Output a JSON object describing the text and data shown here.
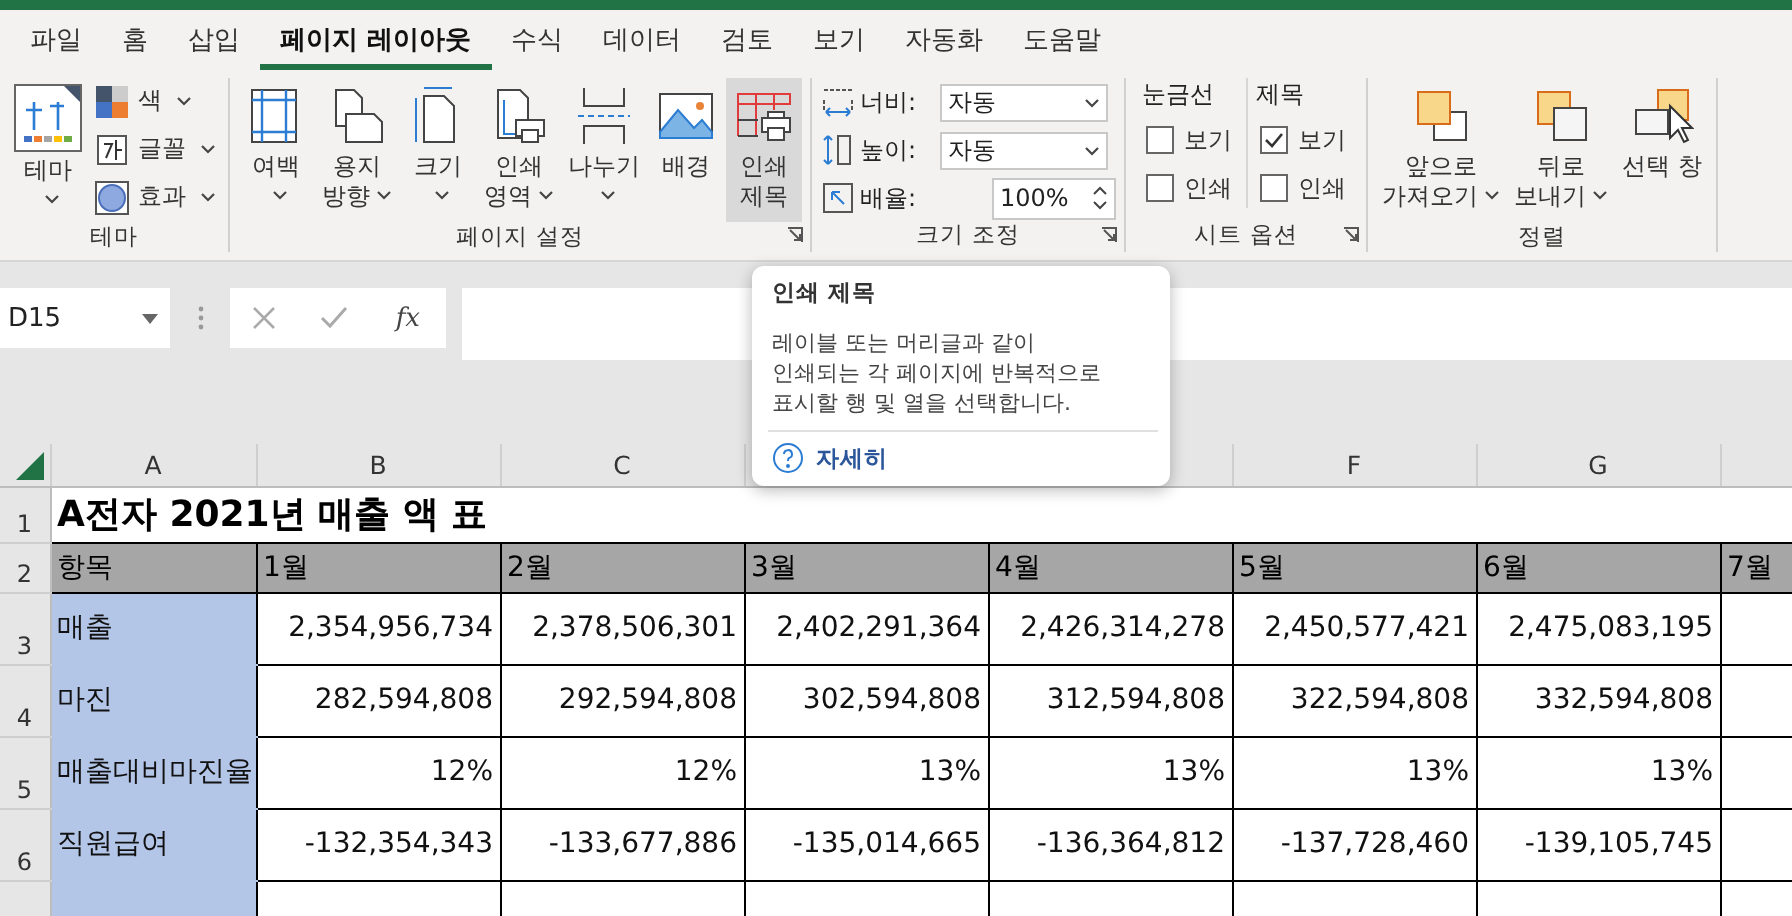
{
  "tabs": [
    {
      "label": "파일",
      "selected": false
    },
    {
      "label": "홈",
      "selected": false
    },
    {
      "label": "삽입",
      "selected": false
    },
    {
      "label": "페이지 레이아웃",
      "selected": true
    },
    {
      "label": "수식",
      "selected": false
    },
    {
      "label": "데이터",
      "selected": false
    },
    {
      "label": "검토",
      "selected": false
    },
    {
      "label": "보기",
      "selected": false
    },
    {
      "label": "자동화",
      "selected": false
    },
    {
      "label": "도움말",
      "selected": false
    }
  ],
  "ribbon": {
    "groups": [
      {
        "kind": "theme",
        "label": "테마",
        "large": {
          "label": "테마",
          "dropdown": true
        },
        "items": [
          {
            "label": "색",
            "dropdown": true
          },
          {
            "label": "글꼴",
            "dropdown": true
          },
          {
            "label": "효과",
            "dropdown": true
          }
        ]
      },
      {
        "kind": "buttons",
        "label": "페이지 설정",
        "launcher": true,
        "buttons": [
          {
            "lines": [
              "여백"
            ],
            "dropdown": true,
            "highlighted": false
          },
          {
            "lines": [
              "용지",
              "방향"
            ],
            "dropdown": true,
            "highlighted": false
          },
          {
            "lines": [
              "크기"
            ],
            "dropdown": true,
            "highlighted": false
          },
          {
            "lines": [
              "인쇄",
              "영역"
            ],
            "dropdown": true,
            "highlighted": false
          },
          {
            "lines": [
              "나누기"
            ],
            "dropdown": true,
            "highlighted": false
          },
          {
            "lines": [
              "배경"
            ],
            "dropdown": false,
            "highlighted": false
          },
          {
            "lines": [
              "인쇄",
              "제목"
            ],
            "dropdown": false,
            "highlighted": true
          }
        ]
      },
      {
        "kind": "scale",
        "label": "크기 조정",
        "launcher": true,
        "fields": [
          {
            "kind": "dropdown",
            "label": "너비:",
            "value": "자동"
          },
          {
            "kind": "dropdown",
            "label": "높이:",
            "value": "자동"
          },
          {
            "kind": "spinner",
            "label": "배율:",
            "value": "100%"
          }
        ]
      },
      {
        "kind": "sheet_options",
        "label": "시트 옵션",
        "launcher": true,
        "sections": [
          {
            "title": "눈금선",
            "options": [
              {
                "label": "보기",
                "checked": false
              },
              {
                "label": "인쇄",
                "checked": false
              }
            ]
          },
          {
            "title": "제목",
            "options": [
              {
                "label": "보기",
                "checked": true
              },
              {
                "label": "인쇄",
                "checked": false
              }
            ]
          }
        ]
      },
      {
        "kind": "buttons",
        "label": "정렬",
        "launcher": false,
        "buttons": [
          {
            "lines": [
              "앞으로",
              "가져오기"
            ],
            "dropdown": true,
            "highlighted": false
          },
          {
            "lines": [
              "뒤로",
              "보내기"
            ],
            "dropdown": true,
            "highlighted": false
          },
          {
            "lines": [
              "선택 창"
            ],
            "dropdown": false,
            "highlighted": false
          }
        ]
      }
    ]
  },
  "formula_bar": {
    "name_box": "D15",
    "function_label": "fx"
  },
  "tooltip": {
    "title": "인쇄 제목",
    "body": "레이블 또는 머리글과 같이\n인쇄되는 각 페이지에 반복적으로\n표시할 행 및 열을 선택합니다.",
    "link": "자세히"
  },
  "sheet": {
    "columns": [
      {
        "label": "A"
      },
      {
        "label": "B"
      },
      {
        "label": "C"
      },
      {},
      {},
      {
        "label": "F"
      },
      {
        "label": "G"
      },
      {}
    ],
    "row_numbers": [
      "1",
      "2",
      "3",
      "4",
      "5",
      "6"
    ],
    "title": "A전자 2021년 매출 액 표",
    "header_row": [
      "항목",
      "1월",
      "2월",
      "3월",
      "4월",
      "5월",
      "6월",
      "7월"
    ],
    "rows": [
      {
        "label": "매출",
        "values": [
          "2,354,956,734",
          "2,378,506,301",
          "2,402,291,364",
          "2,426,314,278",
          "2,450,577,421",
          "2,475,083,195"
        ]
      },
      {
        "label": "마진",
        "values": [
          "282,594,808",
          "292,594,808",
          "302,594,808",
          "312,594,808",
          "322,594,808",
          "332,594,808"
        ]
      },
      {
        "label": "매출대비마진율",
        "values": [
          "12%",
          "12%",
          "13%",
          "13%",
          "13%",
          "13%"
        ]
      },
      {
        "label": "직원급여",
        "values": [
          "-132,354,343",
          "-133,677,886",
          "-135,014,665",
          "-136,364,812",
          "-137,728,460",
          "-139,105,745"
        ]
      }
    ]
  }
}
